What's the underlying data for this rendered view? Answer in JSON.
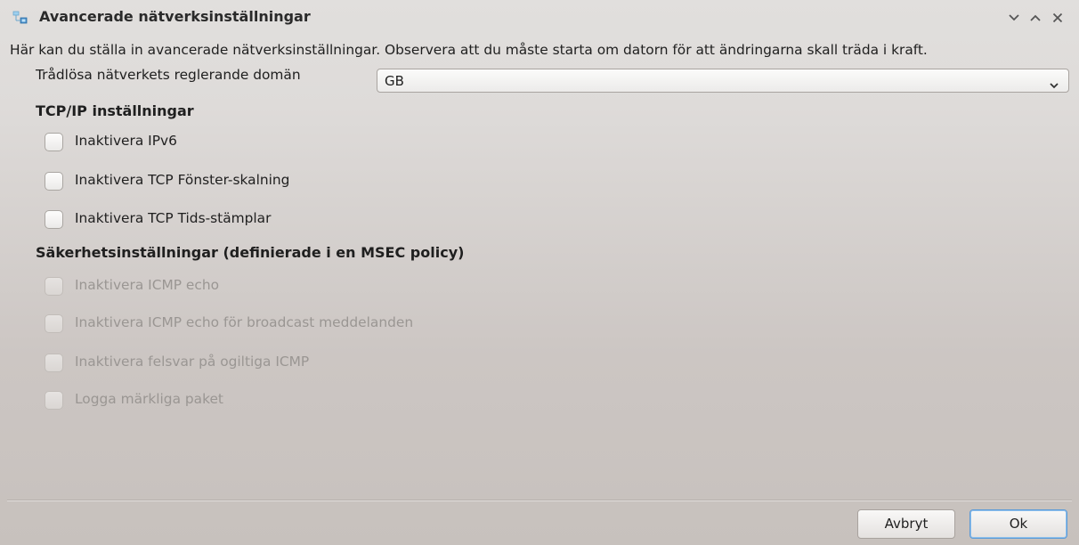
{
  "window": {
    "title": "Avancerade nätverksinställningar"
  },
  "titlebar_buttons": {
    "minimize_icon": "chevron-down-icon",
    "maximize_icon": "chevron-up-icon",
    "close_icon": "close-icon"
  },
  "description": "Här kan du ställa in avancerade nätverksinställningar. Observera att du måste starta om datorn för att ändringarna skall träda i kraft.",
  "wireless": {
    "label": "Trådlösa nätverkets reglerande domän",
    "selected": "GB"
  },
  "tcpip": {
    "heading": "TCP/IP inställningar",
    "options": [
      {
        "label": "Inaktivera IPv6",
        "checked": false,
        "enabled": true
      },
      {
        "label": "Inaktivera TCP Fönster-skalning",
        "checked": false,
        "enabled": true
      },
      {
        "label": "Inaktivera TCP Tids-stämplar",
        "checked": false,
        "enabled": true
      }
    ]
  },
  "security": {
    "heading": "Säkerhetsinställningar (definierade i en MSEC policy)",
    "options": [
      {
        "label": "Inaktivera ICMP echo",
        "checked": false,
        "enabled": false
      },
      {
        "label": "Inaktivera ICMP echo för broadcast meddelanden",
        "checked": false,
        "enabled": false
      },
      {
        "label": "Inaktivera felsvar på ogiltiga ICMP",
        "checked": false,
        "enabled": false
      },
      {
        "label": "Logga märkliga paket",
        "checked": false,
        "enabled": false
      }
    ]
  },
  "buttons": {
    "cancel": "Avbryt",
    "ok": "Ok"
  },
  "colors": {
    "accent": "#5b9bd8",
    "disabled_text": "#9a9693"
  }
}
